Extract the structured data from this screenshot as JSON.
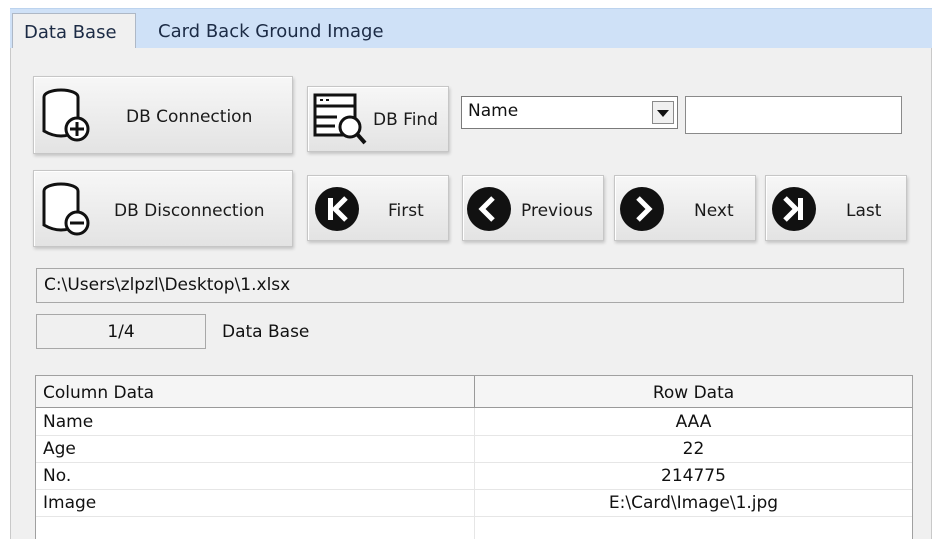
{
  "tabs": [
    {
      "label": "Data Base",
      "active": true
    },
    {
      "label": "Card Back Ground Image",
      "active": false
    }
  ],
  "buttons": {
    "db_connection": "DB Connection",
    "db_find": "DB Find",
    "db_disconnection": "DB Disconnection",
    "first": "First",
    "previous": "Previous",
    "next": "Next",
    "last": "Last"
  },
  "find": {
    "field_selected": "Name",
    "search_value": ""
  },
  "file_path": "C:\\Users\\zlpzl\\Desktop\\1.xlsx",
  "record_position": "1/4",
  "section_label": "Data Base",
  "table": {
    "headers": [
      "Column Data",
      "Row Data"
    ],
    "rows": [
      [
        "Name",
        "AAA"
      ],
      [
        "Age",
        "22"
      ],
      [
        "No.",
        "214775"
      ],
      [
        "Image",
        "E:\\Card\\Image\\1.jpg"
      ]
    ]
  },
  "icons": {
    "db_connection": "database-add-icon",
    "db_find": "database-search-icon",
    "db_disconnection": "database-remove-icon",
    "first": "first-record-icon",
    "previous": "previous-record-icon",
    "next": "next-record-icon",
    "last": "last-record-icon"
  }
}
